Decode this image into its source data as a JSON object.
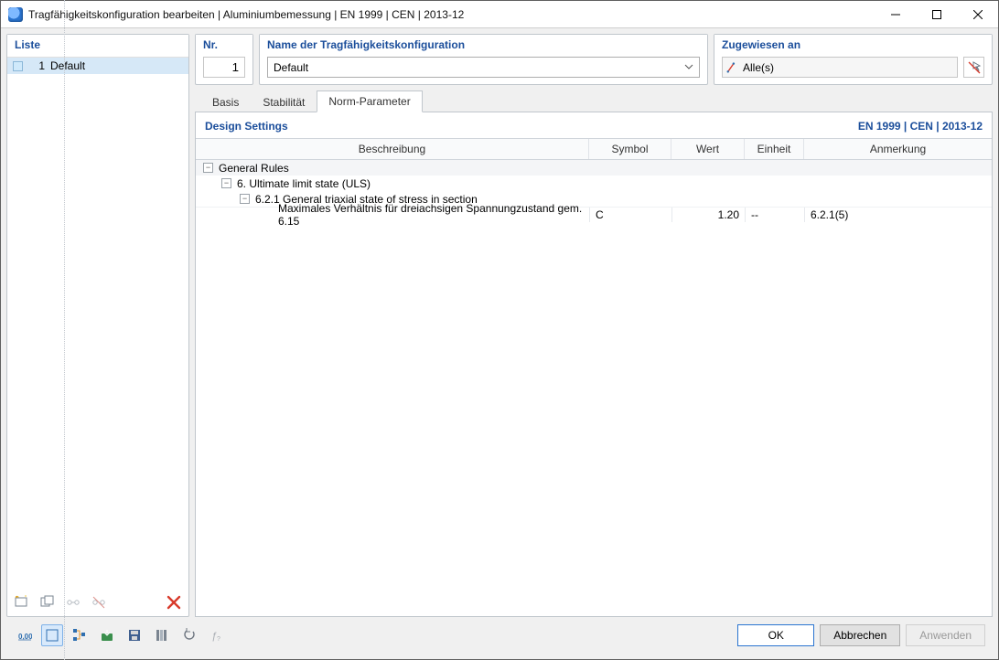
{
  "window_title": "Tragfähigkeitskonfiguration bearbeiten | Aluminiumbemessung | EN 1999 | CEN | 2013-12",
  "left": {
    "header": "Liste",
    "items": [
      {
        "index": "1",
        "name": "Default"
      }
    ]
  },
  "nr": {
    "label": "Nr.",
    "value": "1"
  },
  "name": {
    "label": "Name der Tragfähigkeitskonfiguration",
    "value": "Default"
  },
  "assign": {
    "label": "Zugewiesen an",
    "value": "Alle(s)"
  },
  "tabs": {
    "basis": "Basis",
    "stab": "Stabilität",
    "norm": "Norm-Parameter"
  },
  "section": {
    "left": "Design Settings",
    "right": "EN 1999 | CEN | 2013-12"
  },
  "columns": {
    "desc": "Beschreibung",
    "sym": "Symbol",
    "val": "Wert",
    "unit": "Einheit",
    "note": "Anmerkung"
  },
  "tree": {
    "n1": "General Rules",
    "n2": "6. Ultimate limit state (ULS)",
    "n3": "6.2.1 General triaxial state of stress in section",
    "row": {
      "desc": "Maximales Verhältnis für dreiachsigen Spannungzustand gem. 6.15",
      "sym": "C",
      "val": "1.20",
      "unit": "--",
      "note": "6.2.1(5)"
    }
  },
  "footer": {
    "ok": "OK",
    "cancel": "Abbrechen",
    "apply": "Anwenden"
  }
}
